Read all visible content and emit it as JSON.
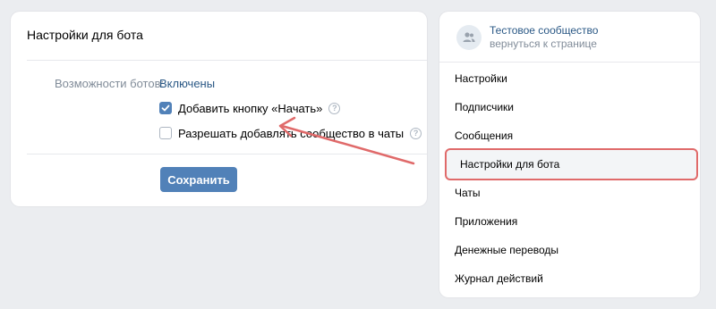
{
  "main": {
    "title": "Настройки для бота",
    "bots_label": "Возможности ботов:",
    "bots_value": "Включены",
    "option_start_button": {
      "label": "Добавить кнопку «Начать»",
      "checked": true
    },
    "option_allow_chats": {
      "label": "Разрешать добавлять сообщество в чаты",
      "checked": false
    },
    "help_glyph": "?",
    "save_label": "Сохранить"
  },
  "sidebar": {
    "community_name": "Тестовое сообщество",
    "back_link": "вернуться к странице",
    "items": [
      {
        "label": "Настройки"
      },
      {
        "label": "Подписчики"
      },
      {
        "label": "Сообщения"
      },
      {
        "label": "Настройки для бота",
        "active": true
      },
      {
        "label": "Чаты"
      },
      {
        "label": "Приложения"
      },
      {
        "label": "Денежные переводы"
      },
      {
        "label": "Журнал действий"
      }
    ]
  },
  "colors": {
    "accent": "#5181b8",
    "link": "#2a5885",
    "muted": "#818c99",
    "annotation": "#e06a6a",
    "background": "#ebedf0"
  }
}
